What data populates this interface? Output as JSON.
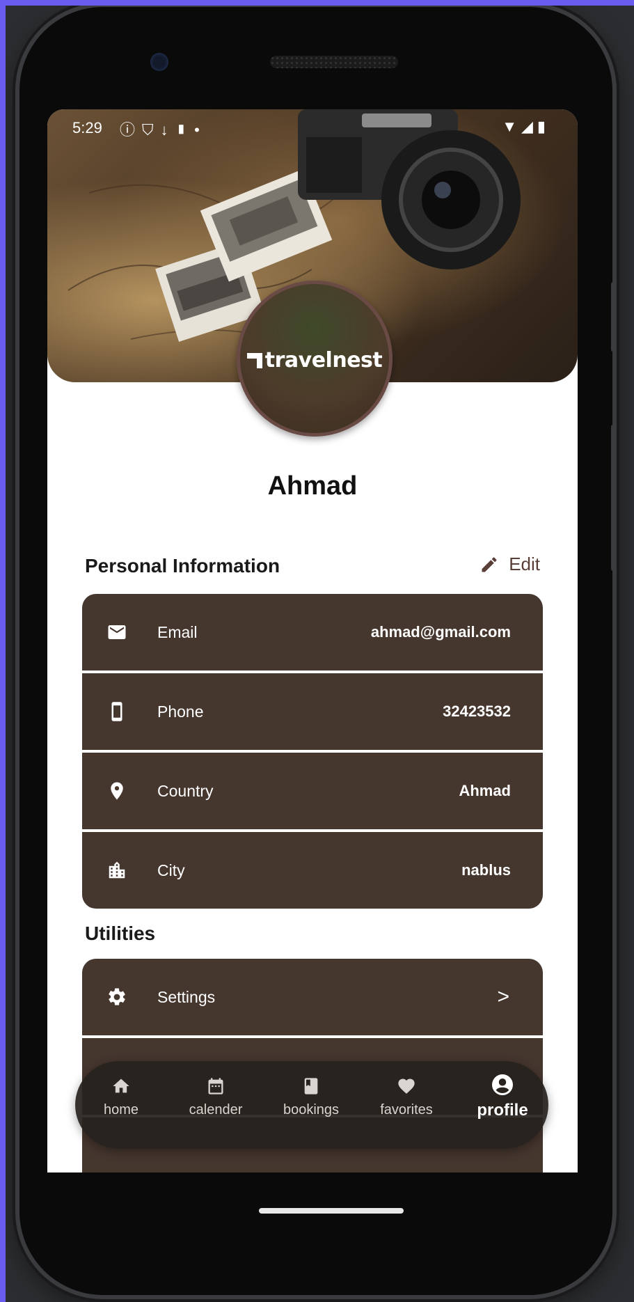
{
  "status_bar": {
    "time": "5:29",
    "left_icons": [
      "info-icon",
      "shield-icon",
      "download-icon",
      "sd-card-icon",
      "dot-icon"
    ],
    "right_icons": [
      "wifi-icon",
      "signal-icon",
      "battery-icon"
    ]
  },
  "profile": {
    "avatar_logo_text": "travelnest",
    "name": "Ahmad"
  },
  "personal_info": {
    "title": "Personal Information",
    "edit_label": "Edit",
    "rows": [
      {
        "icon": "mail-icon",
        "label": "Email",
        "value": "ahmad@gmail.com"
      },
      {
        "icon": "phone-icon",
        "label": "Phone",
        "value": "32423532"
      },
      {
        "icon": "location-pin-icon",
        "label": "Country",
        "value": "Ahmad"
      },
      {
        "icon": "city-icon",
        "label": "City",
        "value": "nablus"
      }
    ]
  },
  "utilities": {
    "title": "Utilities",
    "rows": [
      {
        "icon": "gear-icon",
        "label": "Settings",
        "chevron": ">"
      }
    ]
  },
  "bottom_nav": {
    "items": [
      {
        "icon": "home-icon",
        "label": "home"
      },
      {
        "icon": "calendar-icon",
        "label": "calender"
      },
      {
        "icon": "book-icon",
        "label": "bookings"
      },
      {
        "icon": "heart-icon",
        "label": "favorites"
      },
      {
        "icon": "profile-icon",
        "label": "profile",
        "active": true
      }
    ]
  },
  "colors": {
    "card_background": "#45362e",
    "accent": "#5a3e38",
    "frame_accent": "#6b5cf0"
  }
}
